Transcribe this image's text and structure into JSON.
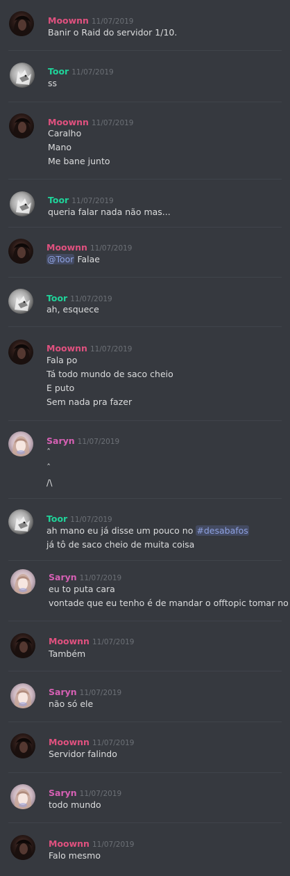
{
  "colors": {
    "background": "#36393f",
    "divider": "#40444b",
    "text": "#dcddde",
    "timestamp": "#6c7076",
    "mention": "#8ea1e1"
  },
  "users": {
    "moownn": {
      "name": "Moownn",
      "color": "#e0517f",
      "avatar": "dark-hair-photo-avatar"
    },
    "toor": {
      "name": "Toor",
      "color": "#1fd49a",
      "avatar": "wolf-photo-avatar"
    },
    "saryn": {
      "name": "Saryn",
      "color": "#d660b4",
      "avatar": "girl-photo-avatar"
    }
  },
  "messages": [
    {
      "author": "Moownn",
      "time": "11/07/2019",
      "lines": [
        "Banir o Raid do servidor 1/10."
      ]
    },
    {
      "author": "Toor",
      "time": "11/07/2019",
      "lines": [
        "ss"
      ]
    },
    {
      "author": "Moownn",
      "time": "11/07/2019",
      "lines": [
        "Caralho",
        "Mano",
        "Me bane junto"
      ]
    },
    {
      "author": "Toor",
      "time": "11/07/2019",
      "lines": [
        "queria falar nada não mas..."
      ]
    },
    {
      "author": "Moownn",
      "time": "11/07/2019",
      "mention": "@Toor",
      "lines": [
        "Falae"
      ]
    },
    {
      "author": "Toor",
      "time": "11/07/2019",
      "lines": [
        "ah, esquece"
      ]
    },
    {
      "author": "Moownn",
      "time": "11/07/2019",
      "lines": [
        "Fala po",
        "Tá todo mundo de saco cheio",
        "E puto",
        "Sem nada pra fazer"
      ]
    },
    {
      "author": "Saryn",
      "time": "11/07/2019",
      "lines": [
        "ˆ",
        "ˆ",
        "/\\"
      ]
    },
    {
      "author": "Toor",
      "time": "11/07/2019",
      "line1_prefix": "ah mano eu já disse um pouco no",
      "channel": "#desabafos",
      "lines": [
        "ah mano eu já disse um pouco no",
        "já tô de saco cheio de muita coisa"
      ]
    },
    {
      "author": "Saryn",
      "time": "11/07/2019",
      "lines": [
        "eu to puta cara",
        "vontade que eu tenho é de mandar o offtopic tomar no cu"
      ]
    },
    {
      "author": "Moownn",
      "time": "11/07/2019",
      "lines": [
        "Também"
      ]
    },
    {
      "author": "Saryn",
      "time": "11/07/2019",
      "lines": [
        "não só ele"
      ]
    },
    {
      "author": "Moownn",
      "time": "11/07/2019",
      "lines": [
        "Servidor falindo"
      ]
    },
    {
      "author": "Saryn",
      "time": "11/07/2019",
      "lines": [
        "todo mundo"
      ]
    },
    {
      "author": "Moownn",
      "time": "11/07/2019",
      "lines": [
        "Falo mesmo"
      ]
    }
  ]
}
